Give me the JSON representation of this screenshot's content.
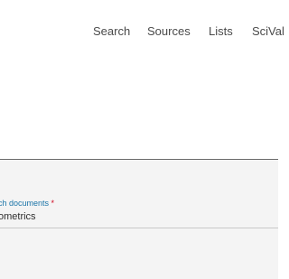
{
  "nav": {
    "items": [
      {
        "label": "Search"
      },
      {
        "label": "Sources"
      },
      {
        "label": "Lists"
      },
      {
        "label": "SciVal"
      }
    ]
  },
  "search": {
    "field_label": "ch documents",
    "required_marker": "*",
    "query_value": "ometrics"
  },
  "colors": {
    "accent": "#1a74a8",
    "required": "#d0021b",
    "panel_background": "#f4f4f4"
  }
}
